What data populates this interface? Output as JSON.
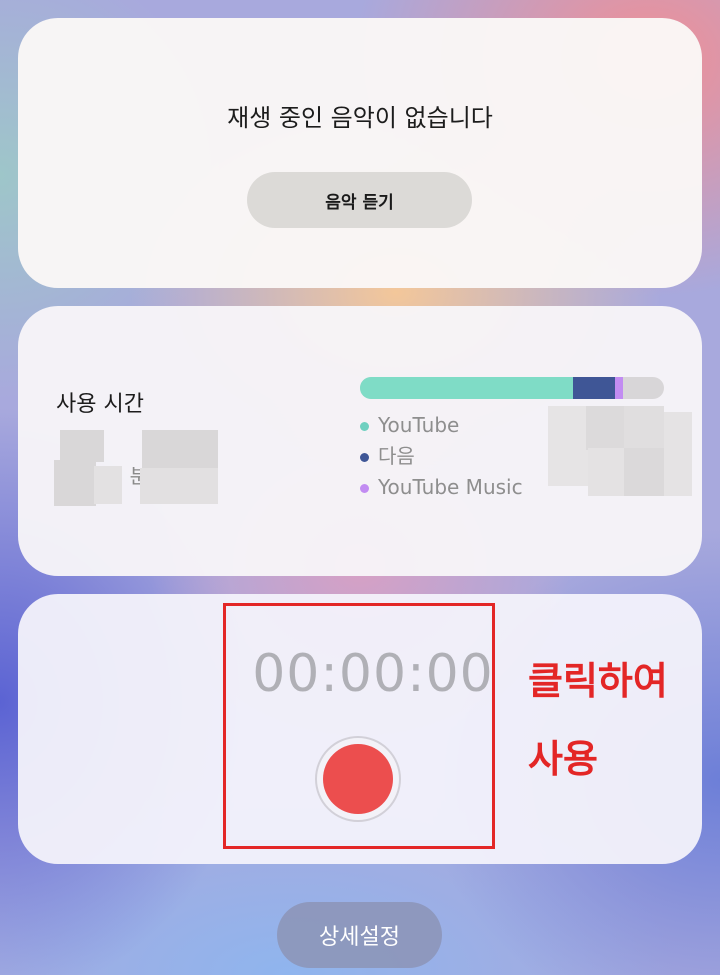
{
  "music": {
    "status": "재생 중인 음악이 없습니다",
    "listen_label": "음악 듣기"
  },
  "usage": {
    "title": "사용 시간",
    "time_partial": "   간      분",
    "bar": {
      "segments": [
        {
          "name": "YouTube",
          "fraction": 0.7,
          "color": "#7fdcc6"
        },
        {
          "name": "다음",
          "fraction": 0.14,
          "color": "#3f5696"
        },
        {
          "name": "YouTube Music",
          "fraction": 0.025,
          "color": "#c28cf2"
        }
      ],
      "track_color": "#d8d6d8"
    },
    "legend": [
      {
        "label": "YouTube",
        "color": "#6fd0c0"
      },
      {
        "label": "다음",
        "color": "#3f5696"
      },
      {
        "label": "YouTube Music",
        "color": "#c28cf2"
      }
    ]
  },
  "recorder": {
    "time": "00:00:00",
    "record_color": "#ec4e4e"
  },
  "annotation": {
    "line1": "클릭하여",
    "line2": "사용",
    "color": "#e32626"
  },
  "footer": {
    "settings_label": "상세설정"
  }
}
